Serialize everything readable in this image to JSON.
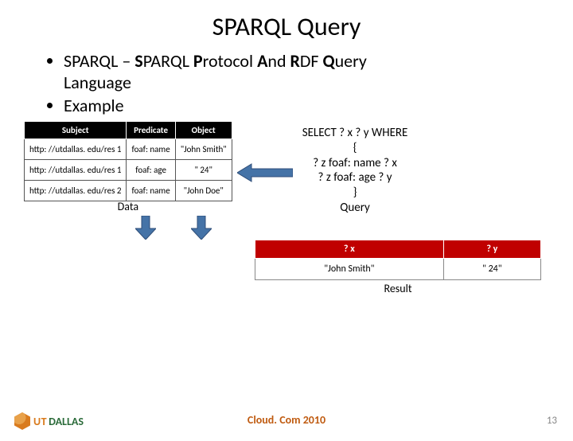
{
  "title": "SPARQL Query",
  "bullets": {
    "line1_prefix": "SPARQL – ",
    "line1_acronym": [
      "S",
      "PARQL ",
      "P",
      "rotocol ",
      "A",
      "nd ",
      "R",
      "DF ",
      "Q",
      "uery"
    ],
    "line1_cont": "Language",
    "line2": "Example"
  },
  "data_table": {
    "headers": [
      "Subject",
      "Predicate",
      "Object"
    ],
    "rows": [
      [
        "http: //utdallas. edu/res 1",
        "foaf: name",
        "\"John Smith\""
      ],
      [
        "http: //utdallas. edu/res 1",
        "foaf: age",
        "\" 24\""
      ],
      [
        "http: //utdallas. edu/res 2",
        "foaf: name",
        "\"John Doe\""
      ]
    ],
    "caption": "Data"
  },
  "query": {
    "l1": "SELECT ? x ? y WHERE",
    "l2": "{",
    "l3": "? z foaf: name  ? x",
    "l4": "? z foaf: age    ? y",
    "l5": "}",
    "l6": "Query"
  },
  "result_table": {
    "headers": [
      "? x",
      "? y"
    ],
    "rows": [
      [
        "\"John Smith\"",
        "\" 24\""
      ]
    ],
    "caption": "Result"
  },
  "footer": "Cloud. Com 2010",
  "page": "13",
  "logo": {
    "ut": "UT",
    "dallas": "DALLAS"
  }
}
